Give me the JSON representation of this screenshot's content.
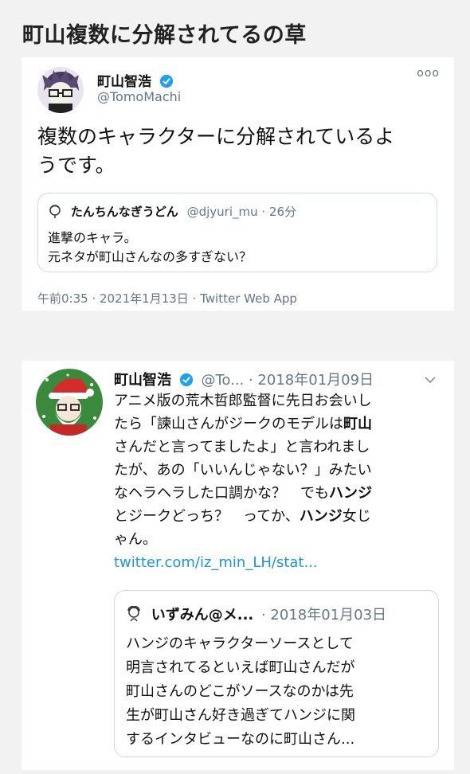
{
  "page": {
    "title": "町山複数に分解されてるの草"
  },
  "tweet1": {
    "author_name": "町山智浩",
    "author_handle": "@TomoMachi",
    "more": "ooo",
    "text_line1": "複数のキャラクターに分解されているよ",
    "text_line2": "うです。",
    "quote": {
      "author_name": "たんちんなぎうどん",
      "meta": "@djyuri_mu · 26分",
      "text_line1": "進撃のキャラ。",
      "text_line2": "元ネタが町山さんなの多すぎない？"
    },
    "footer": "午前0:35 · 2021年1月13日 · Twitter Web App"
  },
  "tweet2": {
    "author_name": "町山智浩",
    "meta": "@To... · 2018年01月09日",
    "text": {
      "p1": "アニメ版の荒木哲郎監督に先日お会いし",
      "p2": "たら「諫山さんがジークのモデルは",
      "p2b": "町山",
      "p3": "さんだと言ってましたよ」と言われまし",
      "p4": "たが、あの「いいんじゃない？」みたい",
      "p5a": "なヘラヘラした口調かな？　でも",
      "p5b": "ハンジ",
      "p6a": "とジークどっち？　ってか、",
      "p6b": "ハンジ",
      "p6c": "女じ",
      "p7": "ゃん。"
    },
    "link": "twitter.com/iz_min_LH/stat...",
    "quote": {
      "author_name": "いずみん@メ...",
      "meta": "· 2018年01月03日",
      "lines": [
        "ハンジのキャラクターソースとして",
        "明言されてるといえば町山さんだが",
        "町山さんのどこがソースなのかは先",
        "生が町山さん好き過ぎてハンジに関",
        "するインタビューなのに町山さん..."
      ]
    }
  },
  "colors": {
    "link": "#1b95e0",
    "verified": "#1da1f2",
    "muted": "#657786"
  }
}
